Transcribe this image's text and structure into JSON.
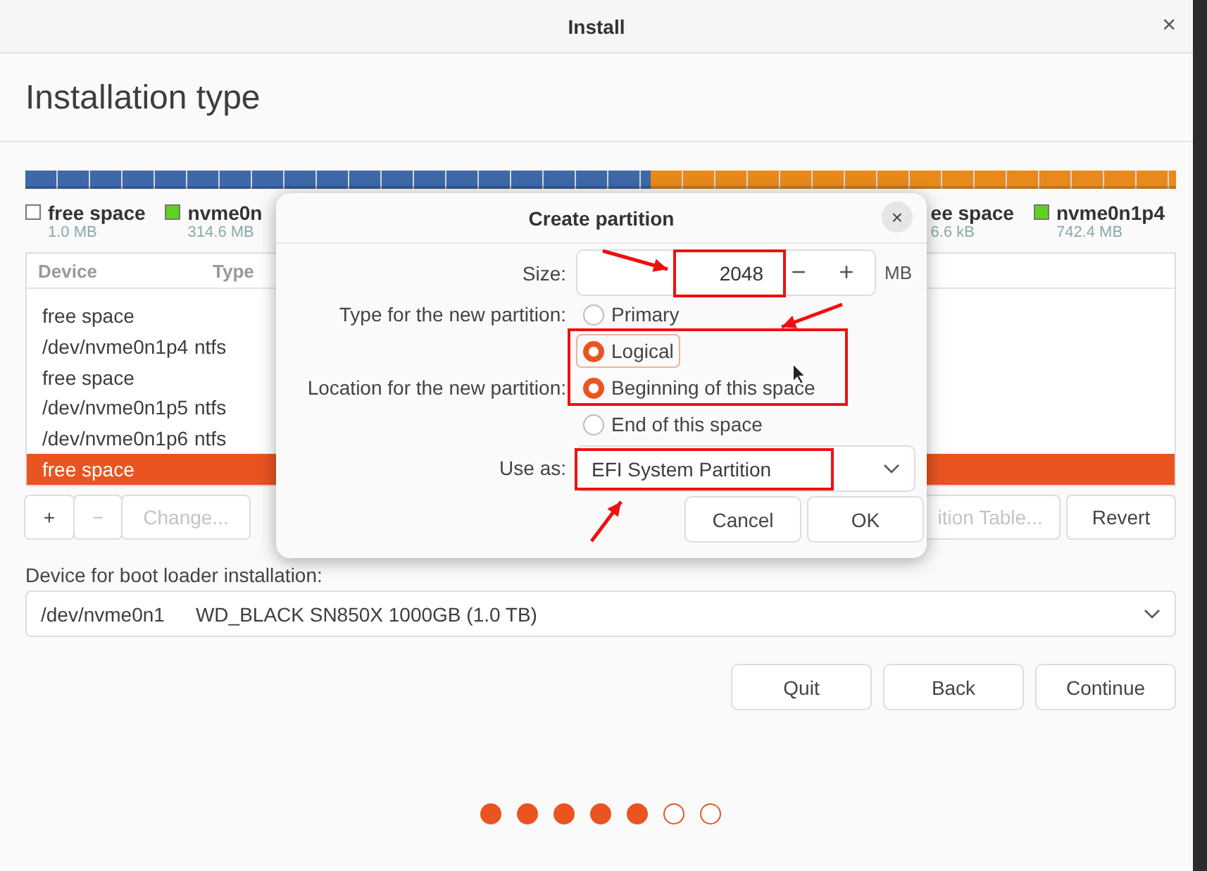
{
  "window": {
    "title": "Install",
    "close": "×"
  },
  "heading": "Installation type",
  "legend_left": [
    {
      "label": "free space",
      "size": "1.0 MB",
      "color": "#ffffff"
    },
    {
      "label": "nvme0n",
      "size": "314.6 MB",
      "color": "#5fd11e"
    }
  ],
  "legend_right": [
    {
      "label": "ee space",
      "size": "6.6 kB"
    },
    {
      "label": "nvme0n1p4",
      "size": "742.4 MB",
      "color": "#5fd11e"
    }
  ],
  "table": {
    "columns": [
      "Device",
      "Type"
    ],
    "rows": [
      {
        "device": "free space",
        "type": "",
        "selected": false
      },
      {
        "device": "/dev/nvme0n1p4",
        "type": "ntfs",
        "selected": false
      },
      {
        "device": "free space",
        "type": "",
        "selected": false
      },
      {
        "device": "/dev/nvme0n1p5",
        "type": "ntfs",
        "selected": false
      },
      {
        "device": "/dev/nvme0n1p6",
        "type": "ntfs",
        "selected": false
      },
      {
        "device": "free space",
        "type": "",
        "selected": true
      }
    ]
  },
  "table_buttons": {
    "add": "+",
    "remove": "−",
    "change": "Change...",
    "new_table": "ition Table...",
    "revert": "Revert"
  },
  "boot_loader": {
    "label": "Device for boot loader installation:",
    "device": "/dev/nvme0n1",
    "model": "WD_BLACK SN850X 1000GB (1.0 TB)"
  },
  "buttons": [
    "Quit",
    "Back",
    "Continue"
  ],
  "steps": [
    {
      "done": true
    },
    {
      "done": true
    },
    {
      "done": true
    },
    {
      "done": true
    },
    {
      "done": true
    },
    {
      "done": false
    },
    {
      "done": false
    }
  ],
  "dialog": {
    "title": "Create partition",
    "close": "×",
    "size_label": "Size:",
    "size": "2048",
    "minus": "−",
    "plus": "+",
    "unit": "MB",
    "type_label": "Type for the new partition:",
    "types": [
      {
        "label": "Primary",
        "selected": false
      },
      {
        "label": "Logical",
        "selected": true
      }
    ],
    "location_label": "Location for the new partition:",
    "locations": [
      {
        "label": "Beginning of this space",
        "selected": true
      },
      {
        "label": "End of this space",
        "selected": false
      }
    ],
    "use_label": "Use as:",
    "use_as": "EFI System Partition",
    "cancel": "Cancel",
    "ok": "OK"
  }
}
